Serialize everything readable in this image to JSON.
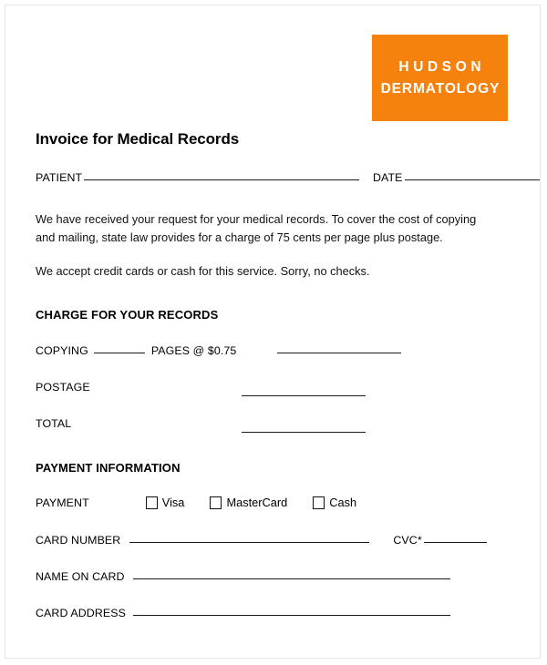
{
  "document": {
    "title": "Invoice for Medical Records"
  },
  "logo": {
    "name": "HUDSON",
    "subtitle": "DERMATOLOGY",
    "background_color": "#f5820d",
    "text_color": "#ffffff"
  },
  "header_fields": {
    "patient_label": "PATIENT",
    "patient_value": "",
    "date_label": "DATE",
    "date_value": ""
  },
  "body": {
    "paragraph_1": "We have received your request for your medical records. To cover the cost of copying and mailing, state law provides for a charge of 75 cents per page plus postage.",
    "paragraph_2": "We accept credit cards or cash for this service. Sorry, no checks."
  },
  "charge_section": {
    "heading": "CHARGE FOR YOUR RECORDS",
    "rows": [
      {
        "label": "COPYING",
        "pages_value": "",
        "rate_text": "PAGES @ $0.75",
        "amount_value": ""
      },
      {
        "label": "POSTAGE",
        "amount_value": ""
      },
      {
        "label": "TOTAL",
        "amount_value": ""
      }
    ]
  },
  "payment_section": {
    "heading": "PAYMENT INFORMATION",
    "payment_label": "PAYMENT",
    "methods": [
      {
        "label": "Visa",
        "checked": false
      },
      {
        "label": "MasterCard",
        "checked": false
      },
      {
        "label": "Cash",
        "checked": false
      }
    ],
    "card_number_label": "CARD NUMBER",
    "card_number_value": "",
    "cvc_label": "CVC*",
    "cvc_value": "",
    "name_on_card_label": "NAME ON CARD",
    "name_on_card_value": "",
    "card_address_label": "CARD ADDRESS",
    "card_address_value": ""
  }
}
